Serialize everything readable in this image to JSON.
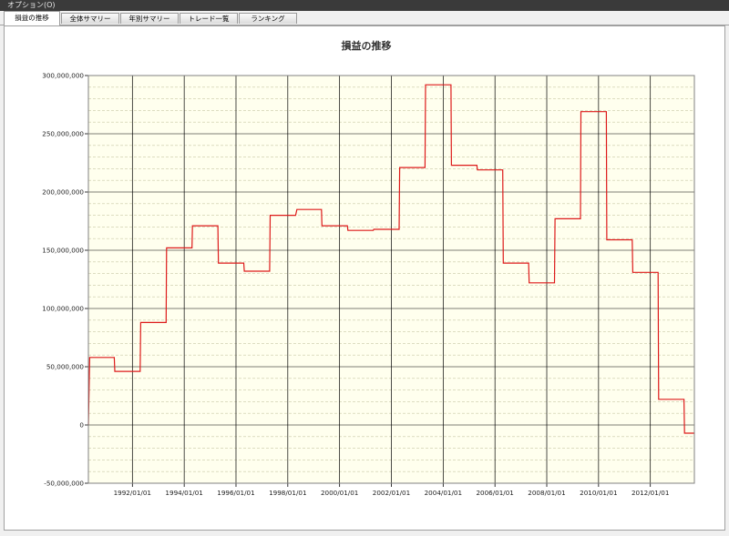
{
  "menubar": {
    "options_label": "オプション(O)"
  },
  "tabs": [
    {
      "label": "損益の推移",
      "active": true
    },
    {
      "label": "全体サマリー",
      "active": false
    },
    {
      "label": "年別サマリー",
      "active": false
    },
    {
      "label": "トレード一覧",
      "active": false
    },
    {
      "label": "ランキング",
      "active": false
    }
  ],
  "colors": {
    "plot_background": "#ffffee",
    "series_line": "#dd1a1a",
    "grid_major": "#000000",
    "grid_minor": "#c9c9a6"
  },
  "chart_data": {
    "type": "line",
    "title": "損益の推移",
    "xlabel": "",
    "ylabel": "",
    "x_tick_labels": [
      "1992/01/01",
      "1994/01/01",
      "1996/01/01",
      "1998/01/01",
      "2000/01/01",
      "2002/01/01",
      "2004/01/01",
      "2006/01/01",
      "2008/01/01",
      "2010/01/01",
      "2012/01/01"
    ],
    "y_tick_labels": [
      "-50,000,000",
      "0",
      "50,000,000",
      "100,000,000",
      "150,000,000",
      "200,000,000",
      "250,000,000",
      "300,000,000"
    ],
    "xlim": [
      1990.3,
      2013.7
    ],
    "ylim": [
      -50000000,
      300000000
    ],
    "grid": true,
    "series": [
      {
        "points": [
          [
            1990.3,
            0
          ],
          [
            1990.35,
            58000000
          ],
          [
            1991.3,
            58000000
          ],
          [
            1991.32,
            46000000
          ],
          [
            1992.3,
            46000000
          ],
          [
            1992.32,
            88000000
          ],
          [
            1993.3,
            88000000
          ],
          [
            1993.32,
            152000000
          ],
          [
            1994.3,
            152000000
          ],
          [
            1994.32,
            171000000
          ],
          [
            1995.3,
            171000000
          ],
          [
            1995.32,
            139000000
          ],
          [
            1996.3,
            139000000
          ],
          [
            1996.32,
            132000000
          ],
          [
            1997.3,
            132000000
          ],
          [
            1997.32,
            180000000
          ],
          [
            1998.3,
            180000000
          ],
          [
            1998.35,
            185000000
          ],
          [
            1999.3,
            185000000
          ],
          [
            1999.32,
            171000000
          ],
          [
            2000.3,
            171000000
          ],
          [
            2000.32,
            167000000
          ],
          [
            2001.3,
            167000000
          ],
          [
            2001.32,
            168000000
          ],
          [
            2002.3,
            168000000
          ],
          [
            2002.32,
            221000000
          ],
          [
            2003.3,
            221000000
          ],
          [
            2003.32,
            292000000
          ],
          [
            2004.3,
            292000000
          ],
          [
            2004.32,
            223000000
          ],
          [
            2005.3,
            223000000
          ],
          [
            2005.32,
            219000000
          ],
          [
            2006.3,
            219000000
          ],
          [
            2006.32,
            139000000
          ],
          [
            2007.3,
            139000000
          ],
          [
            2007.32,
            122000000
          ],
          [
            2008.3,
            122000000
          ],
          [
            2008.32,
            177000000
          ],
          [
            2009.3,
            177000000
          ],
          [
            2009.32,
            269000000
          ],
          [
            2010.3,
            269000000
          ],
          [
            2010.32,
            159000000
          ],
          [
            2011.3,
            159000000
          ],
          [
            2011.32,
            131000000
          ],
          [
            2012.3,
            131000000
          ],
          [
            2012.32,
            22000000
          ],
          [
            2013.3,
            22000000
          ],
          [
            2013.32,
            -7000000
          ],
          [
            2013.7,
            -7000000
          ]
        ]
      }
    ]
  }
}
